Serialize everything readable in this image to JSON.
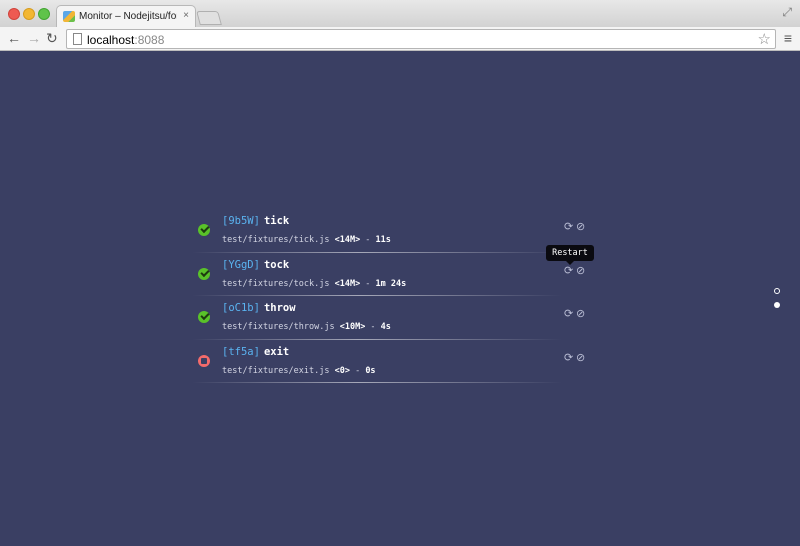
{
  "browser": {
    "tab_title": "Monitor – Nodejitsu/forever",
    "tab_close": "×",
    "url_host": "localhost",
    "url_port": ":8088",
    "icons": {
      "back": "←",
      "forward": "→",
      "reload": "↻",
      "star": "☆",
      "menu": "≡",
      "fullscreen": "⤢"
    }
  },
  "processes": [
    {
      "id": "[9b5W]",
      "name": "tick",
      "file": "test/fixtures/tick.js",
      "mem": "<14M>",
      "sep": " - ",
      "uptime": "11s",
      "status": "running"
    },
    {
      "id": "[YGgD]",
      "name": "tock",
      "file": "test/fixtures/tock.js",
      "mem": "<14M>",
      "sep": " - ",
      "uptime": "1m 24s",
      "status": "running"
    },
    {
      "id": "[oC1b]",
      "name": "throw",
      "file": "test/fixtures/throw.js",
      "mem": "<10M>",
      "sep": " - ",
      "uptime": "4s",
      "status": "running"
    },
    {
      "id": "[tf5a]",
      "name": "exit",
      "file": "test/fixtures/exit.js",
      "mem": "<0>",
      "sep": " - ",
      "uptime": "0s",
      "status": "stopped"
    }
  ],
  "actions": {
    "restart_glyph": "⟳",
    "stop_glyph": "⊘"
  },
  "tooltip": {
    "text": "Restart"
  },
  "colors": {
    "background": "#3a3f63",
    "id": "#5ab3f0",
    "running": "#59c229",
    "stopped": "#f36b6b"
  }
}
